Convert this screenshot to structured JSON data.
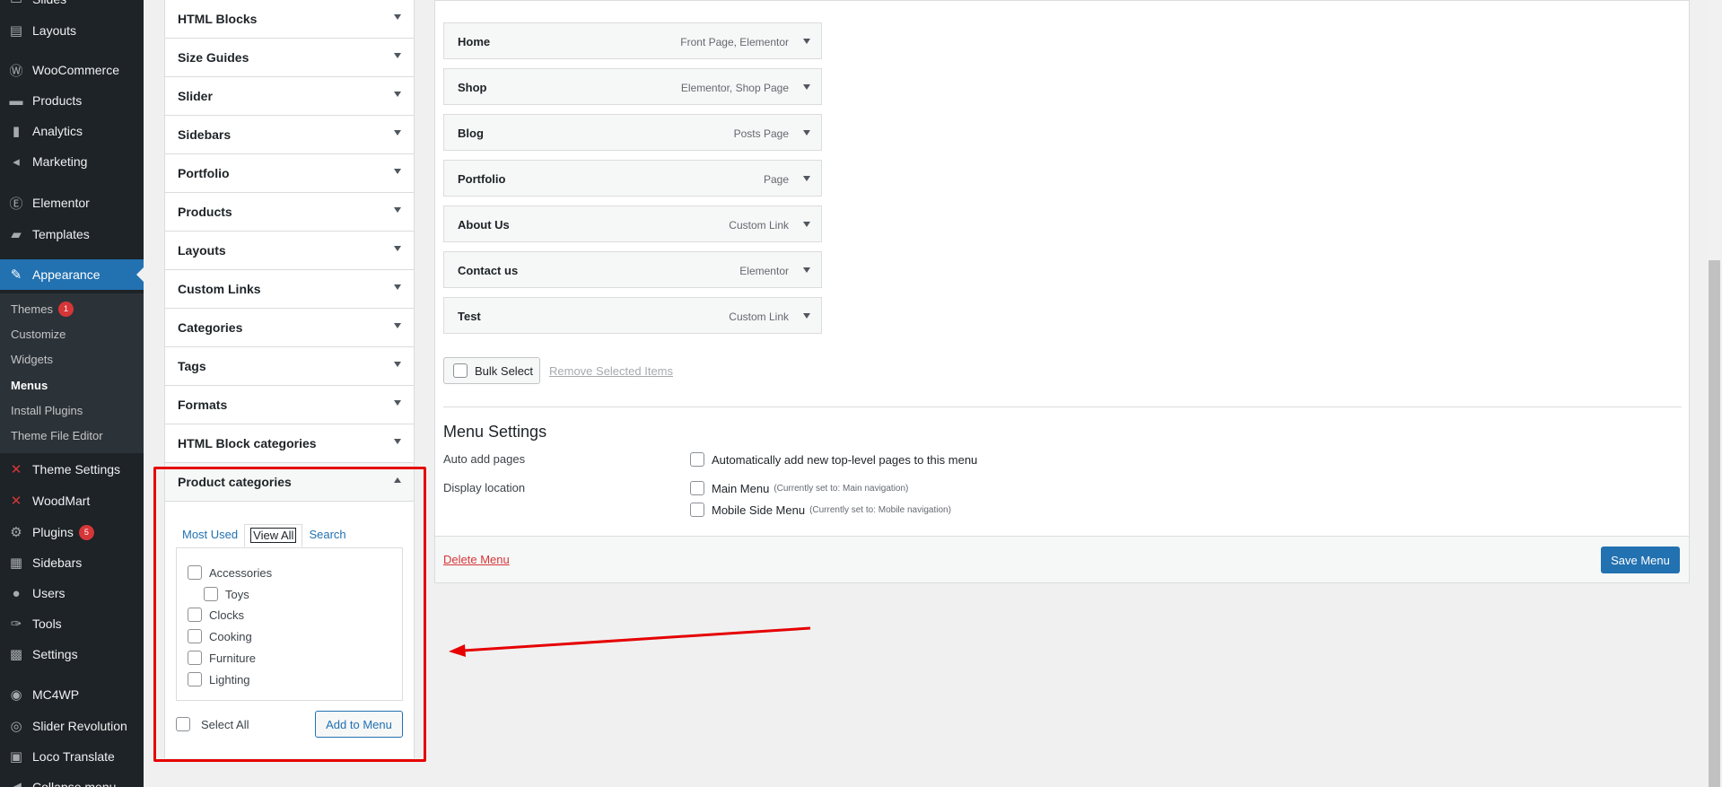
{
  "sidebar": {
    "items": [
      {
        "label": "Slides",
        "icon": "slides-icon",
        "glyph": "▭"
      },
      {
        "label": "Layouts",
        "icon": "layouts-icon",
        "glyph": "▤"
      },
      {
        "label": "WooCommerce",
        "icon": "woocommerce-icon",
        "glyph": "Ⓦ"
      },
      {
        "label": "Products",
        "icon": "products-icon",
        "glyph": "▬"
      },
      {
        "label": "Analytics",
        "icon": "analytics-icon",
        "glyph": "▮"
      },
      {
        "label": "Marketing",
        "icon": "marketing-icon",
        "glyph": "◂"
      },
      {
        "label": "Elementor",
        "icon": "elementor-icon",
        "glyph": "Ⓔ"
      },
      {
        "label": "Templates",
        "icon": "folder-icon",
        "glyph": "▰"
      },
      {
        "label": "Appearance",
        "icon": "paintbrush-icon",
        "glyph": "✎"
      },
      {
        "label": "Theme Settings",
        "icon": "theme-settings-icon",
        "glyph": "✕"
      },
      {
        "label": "WoodMart",
        "icon": "woodmart-icon",
        "glyph": "✕"
      },
      {
        "label": "Plugins",
        "icon": "plugin-icon",
        "glyph": "⚙",
        "badge": "5"
      },
      {
        "label": "Sidebars",
        "icon": "sidebars-icon",
        "glyph": "▦"
      },
      {
        "label": "Users",
        "icon": "user-icon",
        "glyph": "●"
      },
      {
        "label": "Tools",
        "icon": "wrench-icon",
        "glyph": "✑"
      },
      {
        "label": "Settings",
        "icon": "settings-icon",
        "glyph": "▩"
      },
      {
        "label": "MC4WP",
        "icon": "mc4wp-icon",
        "glyph": "◉"
      },
      {
        "label": "Slider Revolution",
        "icon": "slider-revolution-icon",
        "glyph": "◎"
      },
      {
        "label": "Loco Translate",
        "icon": "translate-icon",
        "glyph": "▣"
      },
      {
        "label": "Collapse menu",
        "icon": "collapse-icon",
        "glyph": "◀"
      }
    ],
    "submenu": [
      {
        "label": "Themes",
        "badge": "1"
      },
      {
        "label": "Customize"
      },
      {
        "label": "Widgets"
      },
      {
        "label": "Menus"
      },
      {
        "label": "Install Plugins"
      },
      {
        "label": "Theme File Editor"
      }
    ]
  },
  "accordion": {
    "sections": [
      "HTML Blocks",
      "Size Guides",
      "Slider",
      "Sidebars",
      "Portfolio",
      "Products",
      "Layouts",
      "Custom Links",
      "Categories",
      "Tags",
      "Formats",
      "HTML Block categories",
      "Product categories"
    ],
    "tabs": [
      "Most Used",
      "View All",
      "Search"
    ],
    "categories": [
      "Accessories",
      "Toys",
      "Clocks",
      "Cooking",
      "Furniture",
      "Lighting"
    ],
    "select_all": "Select All",
    "add_to_menu": "Add to Menu"
  },
  "menu": {
    "items": [
      {
        "title": "Home",
        "type": "Front Page, Elementor"
      },
      {
        "title": "Shop",
        "type": "Elementor, Shop Page"
      },
      {
        "title": "Blog",
        "type": "Posts Page"
      },
      {
        "title": "Portfolio",
        "type": "Page"
      },
      {
        "title": "About Us",
        "type": "Custom Link"
      },
      {
        "title": "Contact us",
        "type": "Elementor"
      },
      {
        "title": "Test",
        "type": "Custom Link"
      }
    ],
    "bulk_select": "Bulk Select",
    "remove_selected": "Remove Selected Items",
    "settings_title": "Menu Settings",
    "auto_add_label": "Auto add pages",
    "auto_add_option": "Automatically add new top-level pages to this menu",
    "display_location_label": "Display location",
    "locations": [
      {
        "name": "Main Menu",
        "note": "(Currently set to: Main navigation)"
      },
      {
        "name": "Mobile Side Menu",
        "note": "(Currently set to: Mobile navigation)"
      }
    ],
    "delete_menu": "Delete Menu",
    "save_menu": "Save Menu"
  },
  "colors": {
    "highlight": "#e60000",
    "primary": "#2271b1",
    "sidebar_bg": "#1d2327"
  }
}
